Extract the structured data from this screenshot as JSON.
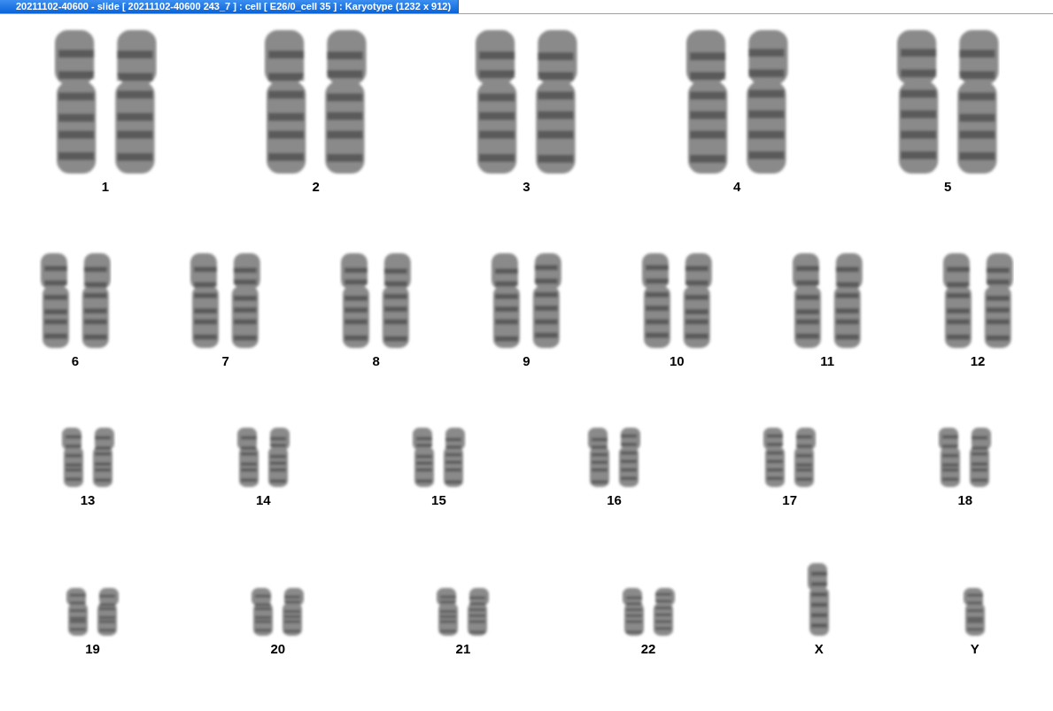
{
  "window": {
    "title": "20211102-40600 - slide [ 20211102-40600 243_7 ] : cell [ E26/0_cell 35 ] : Karyotype  (1232 x 912)"
  },
  "rows": [
    {
      "items": [
        {
          "label": "1",
          "kind": "pair"
        },
        {
          "label": "2",
          "kind": "pair"
        },
        {
          "label": "3",
          "kind": "pair"
        },
        {
          "label": "4",
          "kind": "pair"
        },
        {
          "label": "5",
          "kind": "pair"
        }
      ]
    },
    {
      "items": [
        {
          "label": "6",
          "kind": "pair"
        },
        {
          "label": "7",
          "kind": "pair"
        },
        {
          "label": "8",
          "kind": "pair"
        },
        {
          "label": "9",
          "kind": "pair"
        },
        {
          "label": "10",
          "kind": "pair"
        },
        {
          "label": "11",
          "kind": "pair"
        },
        {
          "label": "12",
          "kind": "pair"
        }
      ]
    },
    {
      "items": [
        {
          "label": "13",
          "kind": "pair"
        },
        {
          "label": "14",
          "kind": "pair"
        },
        {
          "label": "15",
          "kind": "pair"
        },
        {
          "label": "16",
          "kind": "pair"
        },
        {
          "label": "17",
          "kind": "pair"
        },
        {
          "label": "18",
          "kind": "pair"
        }
      ]
    },
    {
      "items": [
        {
          "label": "19",
          "kind": "pair"
        },
        {
          "label": "20",
          "kind": "pair"
        },
        {
          "label": "21",
          "kind": "pair"
        },
        {
          "label": "22",
          "kind": "pair"
        },
        {
          "label": "X",
          "kind": "single"
        },
        {
          "label": "Y",
          "kind": "single"
        }
      ]
    }
  ]
}
